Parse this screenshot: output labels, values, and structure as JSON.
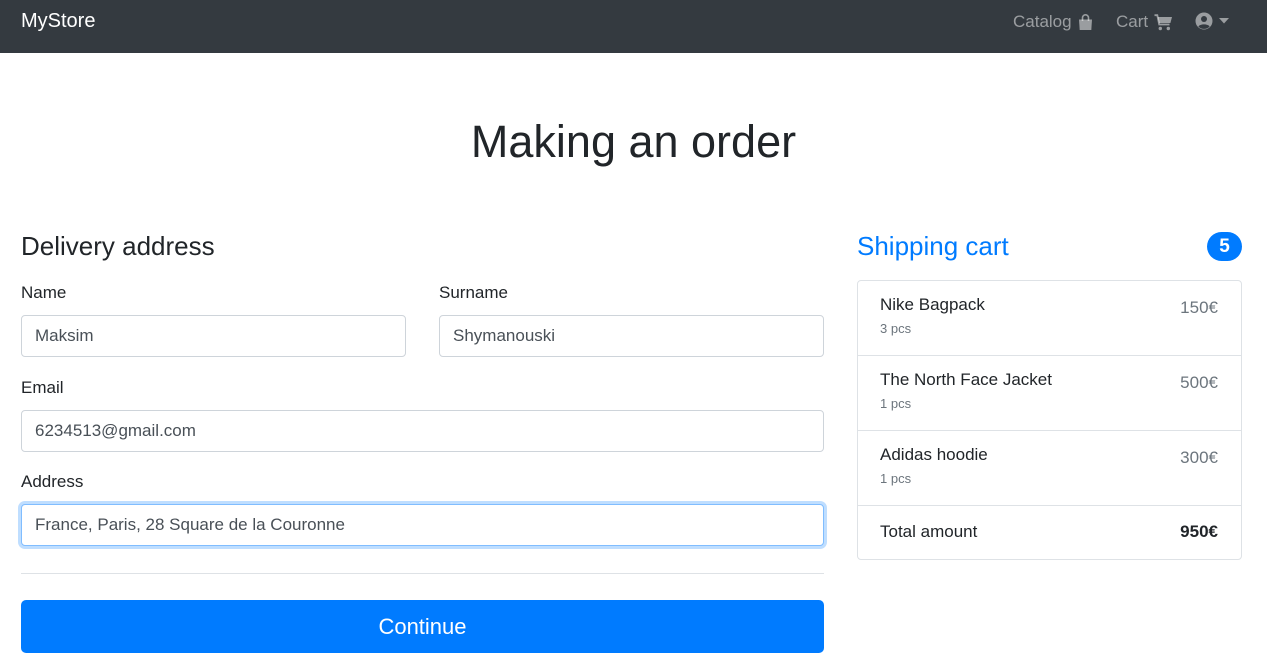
{
  "navbar": {
    "brand": "MyStore",
    "catalog_label": "Catalog",
    "catalog_icon": "shopping-bag-icon",
    "cart_label": "Cart",
    "cart_icon": "shopping-cart-icon",
    "user_icon": "user-circle-icon",
    "user_caret_icon": "caret-down-icon"
  },
  "page": {
    "title": "Making an order"
  },
  "delivery": {
    "heading": "Delivery address",
    "name_label": "Name",
    "name_value": "Maksim",
    "surname_label": "Surname",
    "surname_value": "Shymanouski",
    "email_label": "Email",
    "email_value": "6234513@gmail.com",
    "address_label": "Address",
    "address_value": "France, Paris, 28 Square de la Couronne",
    "continue_label": "Continue"
  },
  "cart": {
    "heading": "Shipping cart",
    "count": "5",
    "items": [
      {
        "name": "Nike Bagpack",
        "qty": "3 pcs",
        "price": "150€"
      },
      {
        "name": "The North Face Jacket",
        "qty": "1 pcs",
        "price": "500€"
      },
      {
        "name": "Adidas hoodie",
        "qty": "1 pcs",
        "price": "300€"
      }
    ],
    "total_label": "Total amount",
    "total_value": "950€"
  },
  "colors": {
    "navbar_bg": "#343a40",
    "accent": "#007bff",
    "muted": "#6c757d",
    "border": "#dee2e6"
  }
}
